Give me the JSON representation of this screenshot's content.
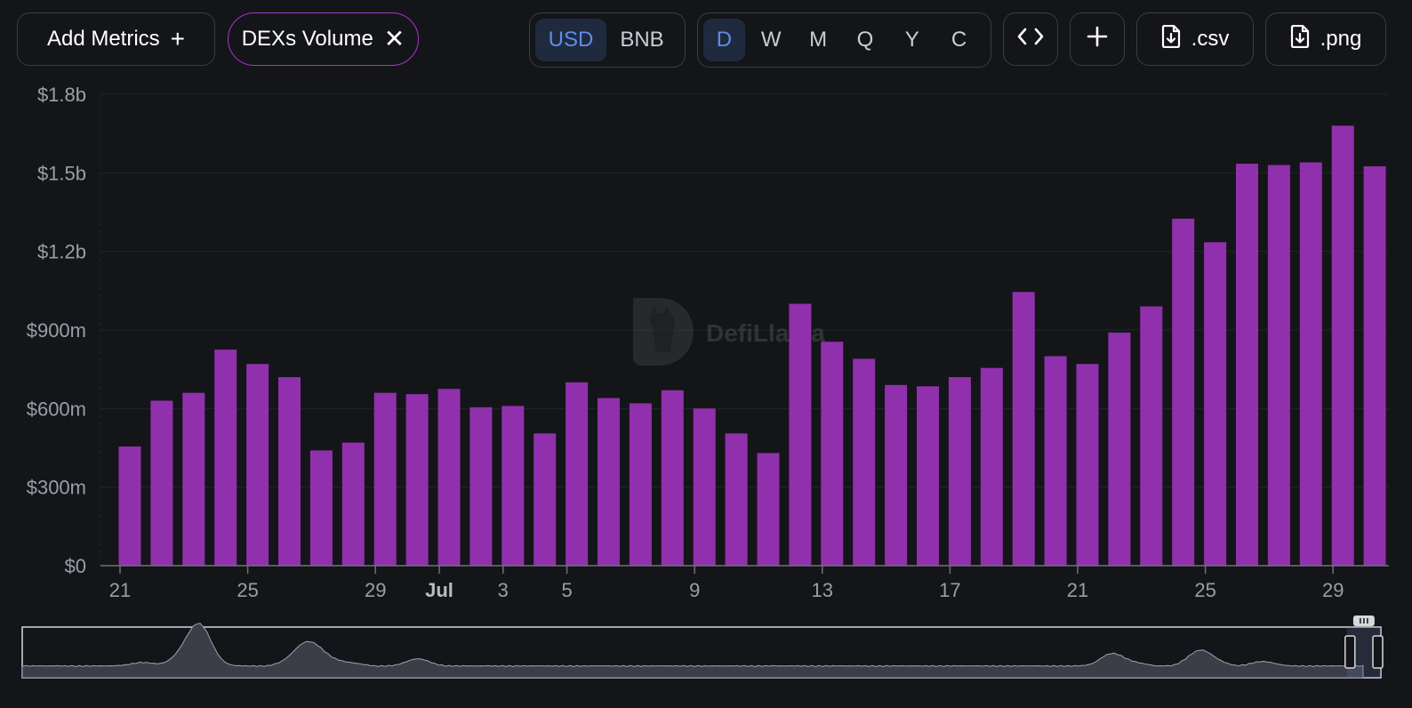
{
  "toolbar": {
    "add_metrics_label": "Add Metrics",
    "metric_chip_label": "DEXs Volume",
    "currency_options": [
      "USD",
      "BNB"
    ],
    "currency_selected": "USD",
    "period_options": [
      "D",
      "W",
      "M",
      "Q",
      "Y",
      "C"
    ],
    "period_selected": "D",
    "csv_label": ".csv",
    "png_label": ".png"
  },
  "watermark": {
    "text": "DefiLlama"
  },
  "colors": {
    "bar": "#9130ad",
    "background": "#141518",
    "accent": "#a437c9",
    "active_bg": "#1f2a3e",
    "active_text": "#5f8de6"
  },
  "chart_data": {
    "type": "bar",
    "title": "",
    "xlabel": "",
    "ylabel": "",
    "ylim": [
      0,
      1800000000
    ],
    "yticks": [
      0,
      300000000,
      600000000,
      900000000,
      1200000000,
      1500000000,
      1800000000
    ],
    "ytick_labels": [
      "$0",
      "$300m",
      "$600m",
      "$900m",
      "$1.2b",
      "$1.5b",
      "$1.8b"
    ],
    "grid": true,
    "categories": [
      "Jun 21",
      "Jun 22",
      "Jun 23",
      "Jun 24",
      "Jun 25",
      "Jun 26",
      "Jun 27",
      "Jun 28",
      "Jun 29",
      "Jun 30",
      "Jul 1",
      "Jul 2",
      "Jul 3",
      "Jul 4",
      "Jul 5",
      "Jul 6",
      "Jul 7",
      "Jul 8",
      "Jul 9",
      "Jul 10",
      "Jul 11",
      "Jul 12",
      "Jul 13",
      "Jul 14",
      "Jul 15",
      "Jul 16",
      "Jul 17",
      "Jul 18",
      "Jul 19",
      "Jul 20",
      "Jul 21",
      "Jul 22",
      "Jul 23",
      "Jul 24",
      "Jul 25",
      "Jul 26",
      "Jul 27",
      "Jul 28",
      "Jul 29",
      "Jul 30"
    ],
    "values": [
      455000000,
      630000000,
      660000000,
      825000000,
      770000000,
      720000000,
      440000000,
      470000000,
      660000000,
      655000000,
      675000000,
      605000000,
      610000000,
      505000000,
      700000000,
      640000000,
      620000000,
      670000000,
      600000000,
      505000000,
      430000000,
      1000000000,
      855000000,
      790000000,
      690000000,
      685000000,
      720000000,
      755000000,
      1045000000,
      800000000,
      770000000,
      890000000,
      990000000,
      1325000000,
      1235000000,
      1535000000,
      1530000000,
      1540000000,
      1680000000,
      1525000000
    ],
    "xtick_labels": [
      {
        "index": 0,
        "label": "21",
        "bold": false
      },
      {
        "index": 4,
        "label": "25",
        "bold": false
      },
      {
        "index": 8,
        "label": "29",
        "bold": false
      },
      {
        "index": 10,
        "label": "Jul",
        "bold": true
      },
      {
        "index": 12,
        "label": "3",
        "bold": false
      },
      {
        "index": 14,
        "label": "5",
        "bold": false
      },
      {
        "index": 18,
        "label": "9",
        "bold": false
      },
      {
        "index": 22,
        "label": "13",
        "bold": false
      },
      {
        "index": 26,
        "label": "17",
        "bold": false
      },
      {
        "index": 30,
        "label": "21",
        "bold": false
      },
      {
        "index": 34,
        "label": "25",
        "bold": false
      },
      {
        "index": 38,
        "label": "29",
        "bold": false
      }
    ],
    "zoom_range": [
      0.975,
      1.0
    ]
  }
}
